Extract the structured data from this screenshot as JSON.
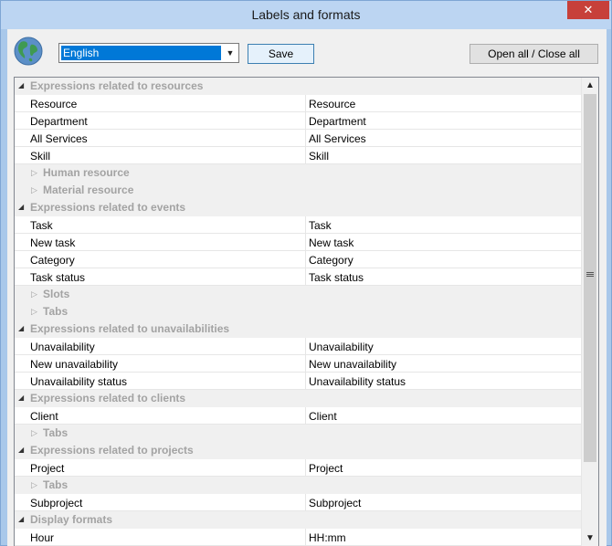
{
  "window": {
    "title": "Labels and formats",
    "close_glyph": "✕"
  },
  "toolbar": {
    "language_value": "English",
    "save_label": "Save",
    "open_close_label": "Open all / Close all"
  },
  "colors": {
    "accent": "#0078d7",
    "group_text": "#a3a3a3",
    "close": "#c7403a"
  },
  "rows": [
    {
      "type": "group",
      "label": "Expressions related to resources"
    },
    {
      "type": "item",
      "key": "Resource",
      "value": "Resource"
    },
    {
      "type": "item",
      "key": "Department",
      "value": "Department"
    },
    {
      "type": "item",
      "key": "All Services",
      "value": "All Services"
    },
    {
      "type": "item",
      "key": "Skill",
      "value": "Skill"
    },
    {
      "type": "subgroup",
      "label": "Human resource"
    },
    {
      "type": "subgroup",
      "label": "Material resource"
    },
    {
      "type": "group",
      "label": "Expressions related to events"
    },
    {
      "type": "item",
      "key": "Task",
      "value": "Task"
    },
    {
      "type": "item",
      "key": "New task",
      "value": "New task"
    },
    {
      "type": "item",
      "key": "Category",
      "value": "Category"
    },
    {
      "type": "item",
      "key": "Task status",
      "value": "Task status"
    },
    {
      "type": "subgroup",
      "label": "Slots"
    },
    {
      "type": "subgroup",
      "label": "Tabs"
    },
    {
      "type": "group",
      "label": "Expressions related to unavailabilities"
    },
    {
      "type": "item",
      "key": "Unavailability",
      "value": "Unavailability"
    },
    {
      "type": "item",
      "key": "New unavailability",
      "value": "New unavailability"
    },
    {
      "type": "item",
      "key": "Unavailability status",
      "value": "Unavailability status"
    },
    {
      "type": "group",
      "label": "Expressions related to clients"
    },
    {
      "type": "item",
      "key": "Client",
      "value": "Client"
    },
    {
      "type": "subgroup",
      "label": "Tabs"
    },
    {
      "type": "group",
      "label": "Expressions related to projects"
    },
    {
      "type": "item",
      "key": "Project",
      "value": "Project"
    },
    {
      "type": "subgroup",
      "label": "Tabs"
    },
    {
      "type": "item",
      "key": "Subproject",
      "value": "Subproject"
    },
    {
      "type": "group",
      "label": "Display formats"
    },
    {
      "type": "item",
      "key": "Hour",
      "value": "HH:mm"
    }
  ]
}
